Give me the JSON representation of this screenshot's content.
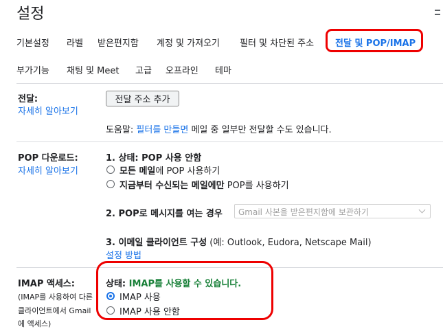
{
  "title": "설정",
  "tabs_row1": [
    {
      "label": "기본설정",
      "active": false
    },
    {
      "label": "라벨",
      "active": false
    },
    {
      "label": "받은편지함",
      "active": false
    },
    {
      "label": "계정 및 가져오기",
      "active": false
    },
    {
      "label": "필터 및 차단된 주소",
      "active": false
    },
    {
      "label": "전달 및 POP/IMAP",
      "active": true
    }
  ],
  "tabs_row2": [
    {
      "label": "부가기능"
    },
    {
      "label": "채팅 및 Meet"
    },
    {
      "label": "고급"
    },
    {
      "label": "오프라인"
    },
    {
      "label": "테마"
    }
  ],
  "forwarding": {
    "label": "전달:",
    "learn_more": "자세히 알아보기",
    "add_button": "전달 주소 추가",
    "tip_prefix": "도움말: ",
    "tip_link": "필터를 만들면",
    "tip_suffix": " 메일 중 일부만 전달할 수도 있습니다."
  },
  "pop": {
    "label": "POP 다운로드:",
    "learn_more": "자세히 알아보기",
    "status": "1. 상태: POP 사용 안함",
    "options": [
      {
        "pre": "모든 메일",
        "post": "에 POP 사용하기",
        "checked": false
      },
      {
        "pre": "지금부터 수신되는 메일에만",
        "post": " POP를 사용하기",
        "checked": false
      }
    ],
    "step2_label": "2. POP로 메시지를 여는 경우",
    "step2_select": "Gmail 사본을 받은편지함에 보관하기",
    "step3_label": "3. 이메일 클라이언트 구성",
    "step3_hint": " (예: Outlook, Eudora, Netscape Mail)",
    "step3_link": "설정 방법"
  },
  "imap": {
    "label": "IMAP 액세스:",
    "desc_line1": "(IMAP를 사용하여 다른",
    "desc_line2": "클라이언트에서 Gmail",
    "desc_line3": "에 액세스)",
    "status_prefix": "상태: ",
    "status_value": "IMAP를 사용할 수 있습니다.",
    "status_color": "#188038",
    "options": [
      {
        "label": "IMAP 사용",
        "checked": true
      },
      {
        "label": "IMAP 사용 안함",
        "checked": false
      }
    ]
  },
  "annotation_color": "#e00000"
}
